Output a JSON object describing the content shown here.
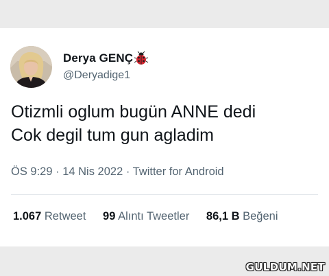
{
  "tweet": {
    "author_name": "Derya GENÇ",
    "author_handle": "@Deryadige1",
    "badge_icon": "ladybug-icon",
    "text_lines": [
      "Otizmli oglum bugün ANNE dedi",
      "Cok degil tum gun agladim"
    ],
    "timestamp": "ÖS 9:29 · 14 Nis 2022 · Twitter for Android"
  },
  "stats": {
    "retweets_count": "1.067",
    "retweets_label": "Retweet",
    "quotes_count": "99",
    "quotes_label": "Alıntı Tweetler",
    "likes_count": "86,1 B",
    "likes_label": "Beğeni"
  },
  "watermark": "GULDUM.NET",
  "colors": {
    "background": "#ebebeb",
    "card": "#ffffff",
    "text_primary": "#0f1419",
    "text_secondary": "#536471",
    "badge_red": "#d4242e"
  }
}
